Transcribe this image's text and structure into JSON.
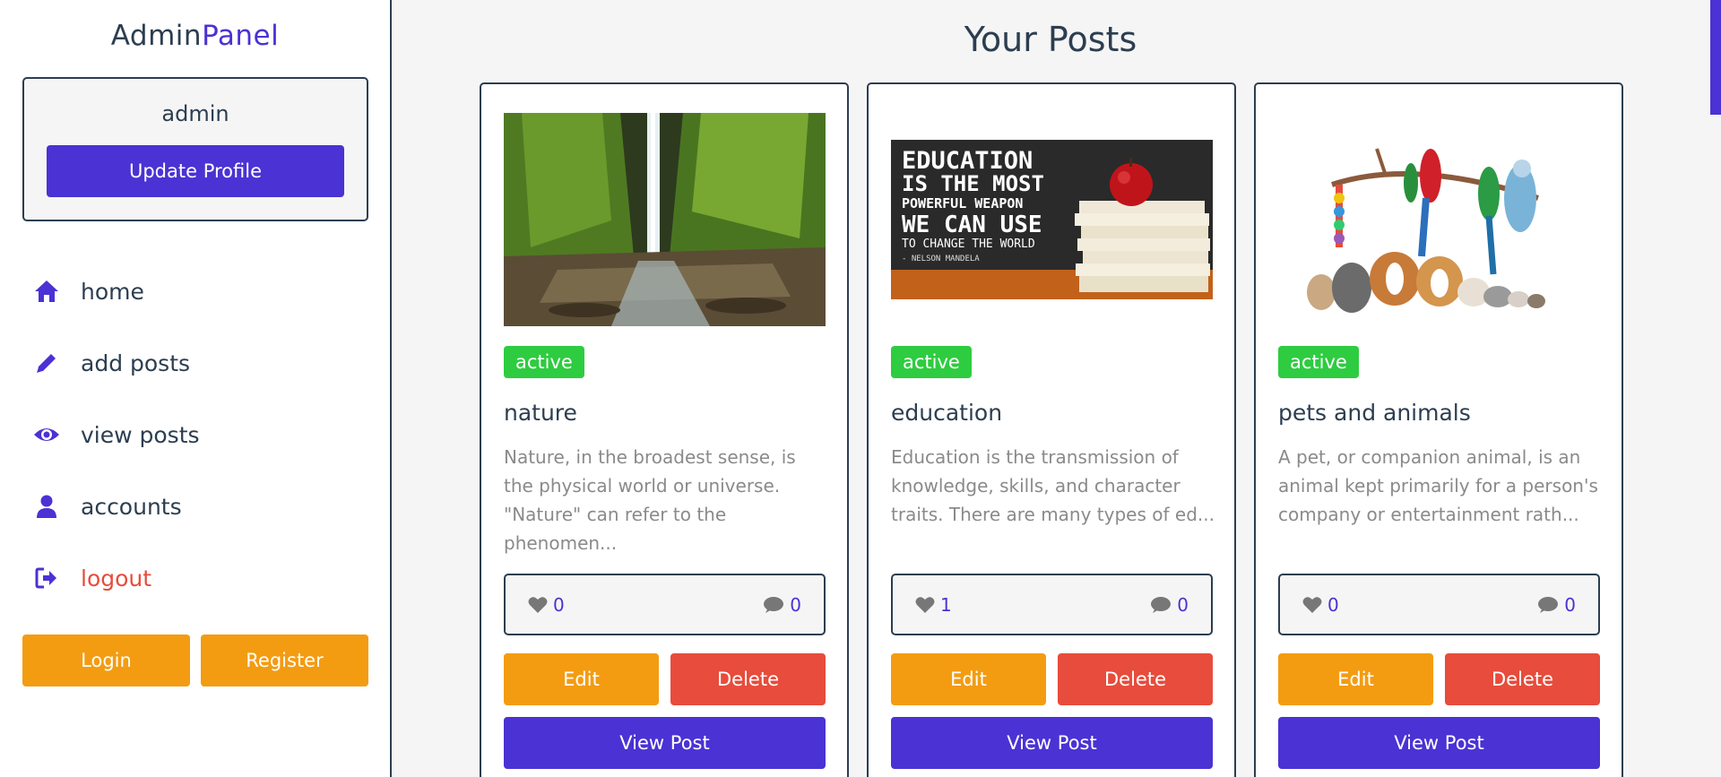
{
  "brand": {
    "part1": "Admin",
    "part2": "Panel",
    "accent_color": "#4a32d4"
  },
  "profile": {
    "username": "admin",
    "update_label": "Update Profile"
  },
  "nav": [
    {
      "label": "home",
      "icon": "home-icon"
    },
    {
      "label": "add posts",
      "icon": "pencil-icon"
    },
    {
      "label": "view posts",
      "icon": "eye-icon"
    },
    {
      "label": "accounts",
      "icon": "user-icon"
    },
    {
      "label": "logout",
      "icon": "logout-icon"
    }
  ],
  "auth": {
    "login_label": "Login",
    "register_label": "Register"
  },
  "page_title": "Your Posts",
  "posts": [
    {
      "status": "active",
      "title": "nature",
      "excerpt": "Nature, in the broadest sense, is the physical world or universe. \"Nature\" can refer to the phenomen...",
      "likes": "0",
      "comments": "0",
      "image": "waterfall-photo"
    },
    {
      "status": "active",
      "title": "education",
      "excerpt": "Education is the transmission of knowledge, skills, and character traits. There are many types of ed...",
      "likes": "1",
      "comments": "0",
      "image": "education-quote-photo",
      "image_text": {
        "line1": "EDUCATION",
        "line2": "IS THE MOST",
        "line3": "POWERFUL WEAPON",
        "line4": "WE CAN USE",
        "line5": "TO CHANGE THE WORLD",
        "line6": "- NELSON MANDELA"
      }
    },
    {
      "status": "active",
      "title": "pets and animals",
      "excerpt": "A pet, or companion animal, is an animal kept primarily for a person's company or entertainment rath...",
      "likes": "0",
      "comments": "0",
      "image": "pets-photo"
    }
  ],
  "actions": {
    "edit_label": "Edit",
    "delete_label": "Delete",
    "view_label": "View Post"
  },
  "colors": {
    "primary": "#4a32d4",
    "edit": "#f39c12",
    "delete": "#e74c3c",
    "active": "#2ecc40",
    "text": "#2c3e50"
  }
}
